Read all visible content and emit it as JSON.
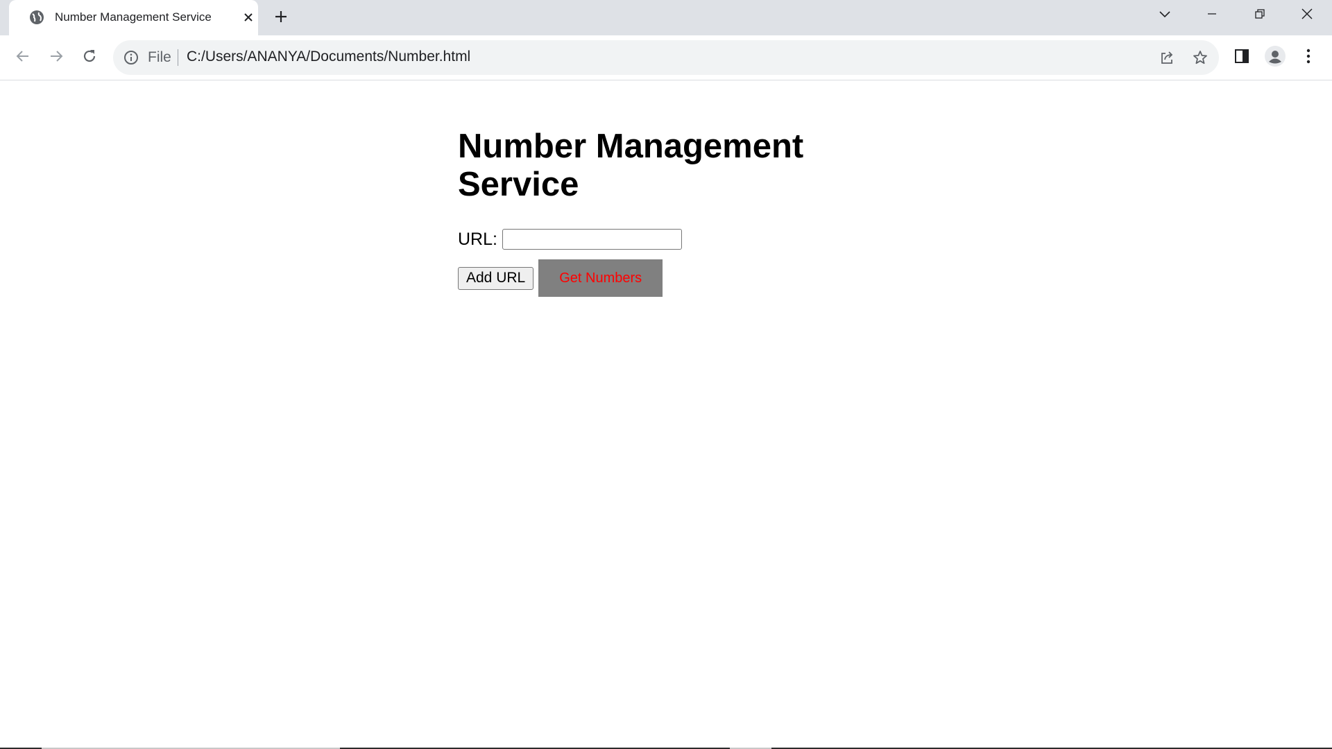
{
  "browser": {
    "tab": {
      "title": "Number Management Service"
    },
    "omnibox": {
      "scheme_label": "File",
      "url": "C:/Users/ANANYA/Documents/Number.html"
    },
    "icons": {
      "favicon": "globe-icon",
      "tab_close": "close-icon",
      "new_tab": "plus-icon",
      "tab_search": "chevron-down-icon",
      "minimize": "minimize-icon",
      "restore": "restore-icon",
      "close_window": "close-icon",
      "back": "arrow-left-icon",
      "forward": "arrow-right-icon",
      "reload": "reload-icon",
      "site_info": "info-icon",
      "share": "share-icon",
      "bookmark": "star-icon",
      "side_panel": "side-panel-icon",
      "profile": "avatar-icon",
      "menu": "kebab-menu-icon"
    }
  },
  "page": {
    "heading": "Number Management Service",
    "url_label": "URL:",
    "url_input_value": "",
    "add_url_label": "Add URL",
    "get_numbers_label": "Get Numbers"
  },
  "colors": {
    "get_numbers_bg": "#808080",
    "get_numbers_text": "#ff0000",
    "tabstrip_bg": "#dee1e6",
    "omnibox_bg": "#f1f3f4"
  }
}
